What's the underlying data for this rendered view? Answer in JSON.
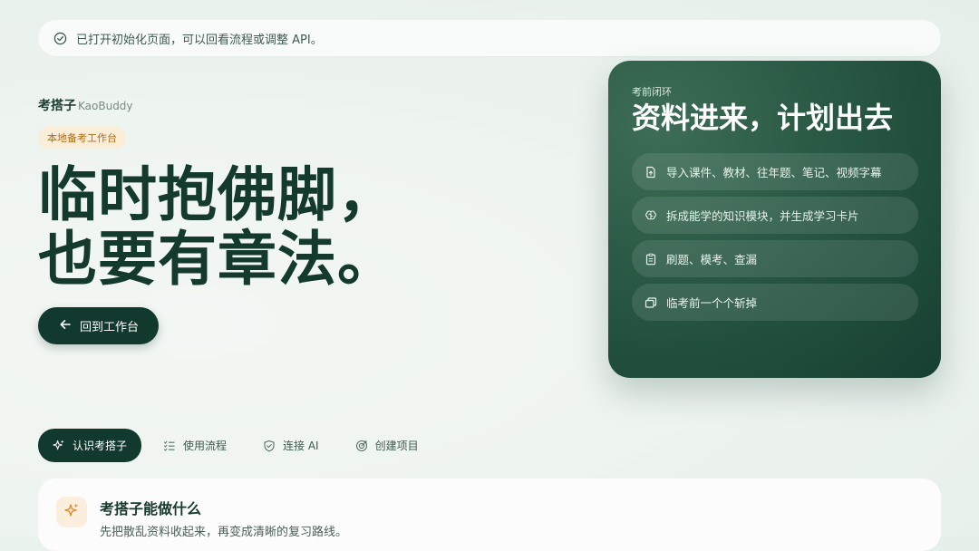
{
  "notice": {
    "text": "已打开初始化页面，可以回看流程或调整 API。",
    "icon": "check-circle-icon"
  },
  "brand": {
    "name_zh": "考搭子",
    "name_en": "KaoBuddy"
  },
  "chip": {
    "label": "本地备考工作台"
  },
  "hero": {
    "line1": "临时抱佛脚，",
    "line2": "也要有章法。"
  },
  "back_button": {
    "label": "回到工作台",
    "icon": "arrow-left-icon"
  },
  "card": {
    "eyebrow": "考前闭环",
    "title": "资料进来，计划出去",
    "items": [
      {
        "label": "导入课件、教材、往年题、笔记、视频字幕",
        "icon": "file-upload-icon"
      },
      {
        "label": "拆成能学的知识模块，并生成学习卡片",
        "icon": "brain-icon"
      },
      {
        "label": "刷题、模考、查漏",
        "icon": "clipboard-icon"
      },
      {
        "label": "临考前一个个斩掉",
        "icon": "stack-icon"
      }
    ]
  },
  "tabs": [
    {
      "label": "认识考搭子",
      "icon": "sparkle-icon",
      "active": true
    },
    {
      "label": "使用流程",
      "icon": "list-check-icon",
      "active": false
    },
    {
      "label": "连接 AI",
      "icon": "shield-icon",
      "active": false
    },
    {
      "label": "创建项目",
      "icon": "target-icon",
      "active": false
    }
  ],
  "panel": {
    "title": "考搭子能做什么",
    "subtitle": "先把散乱资料收起来，再变成清晰的复习路线。",
    "icon": "sparkle-icon"
  },
  "colors": {
    "primary": "#12392d",
    "accent": "#b06c18",
    "chip_bg": "#fbeed8",
    "background": "#eef4f0"
  }
}
